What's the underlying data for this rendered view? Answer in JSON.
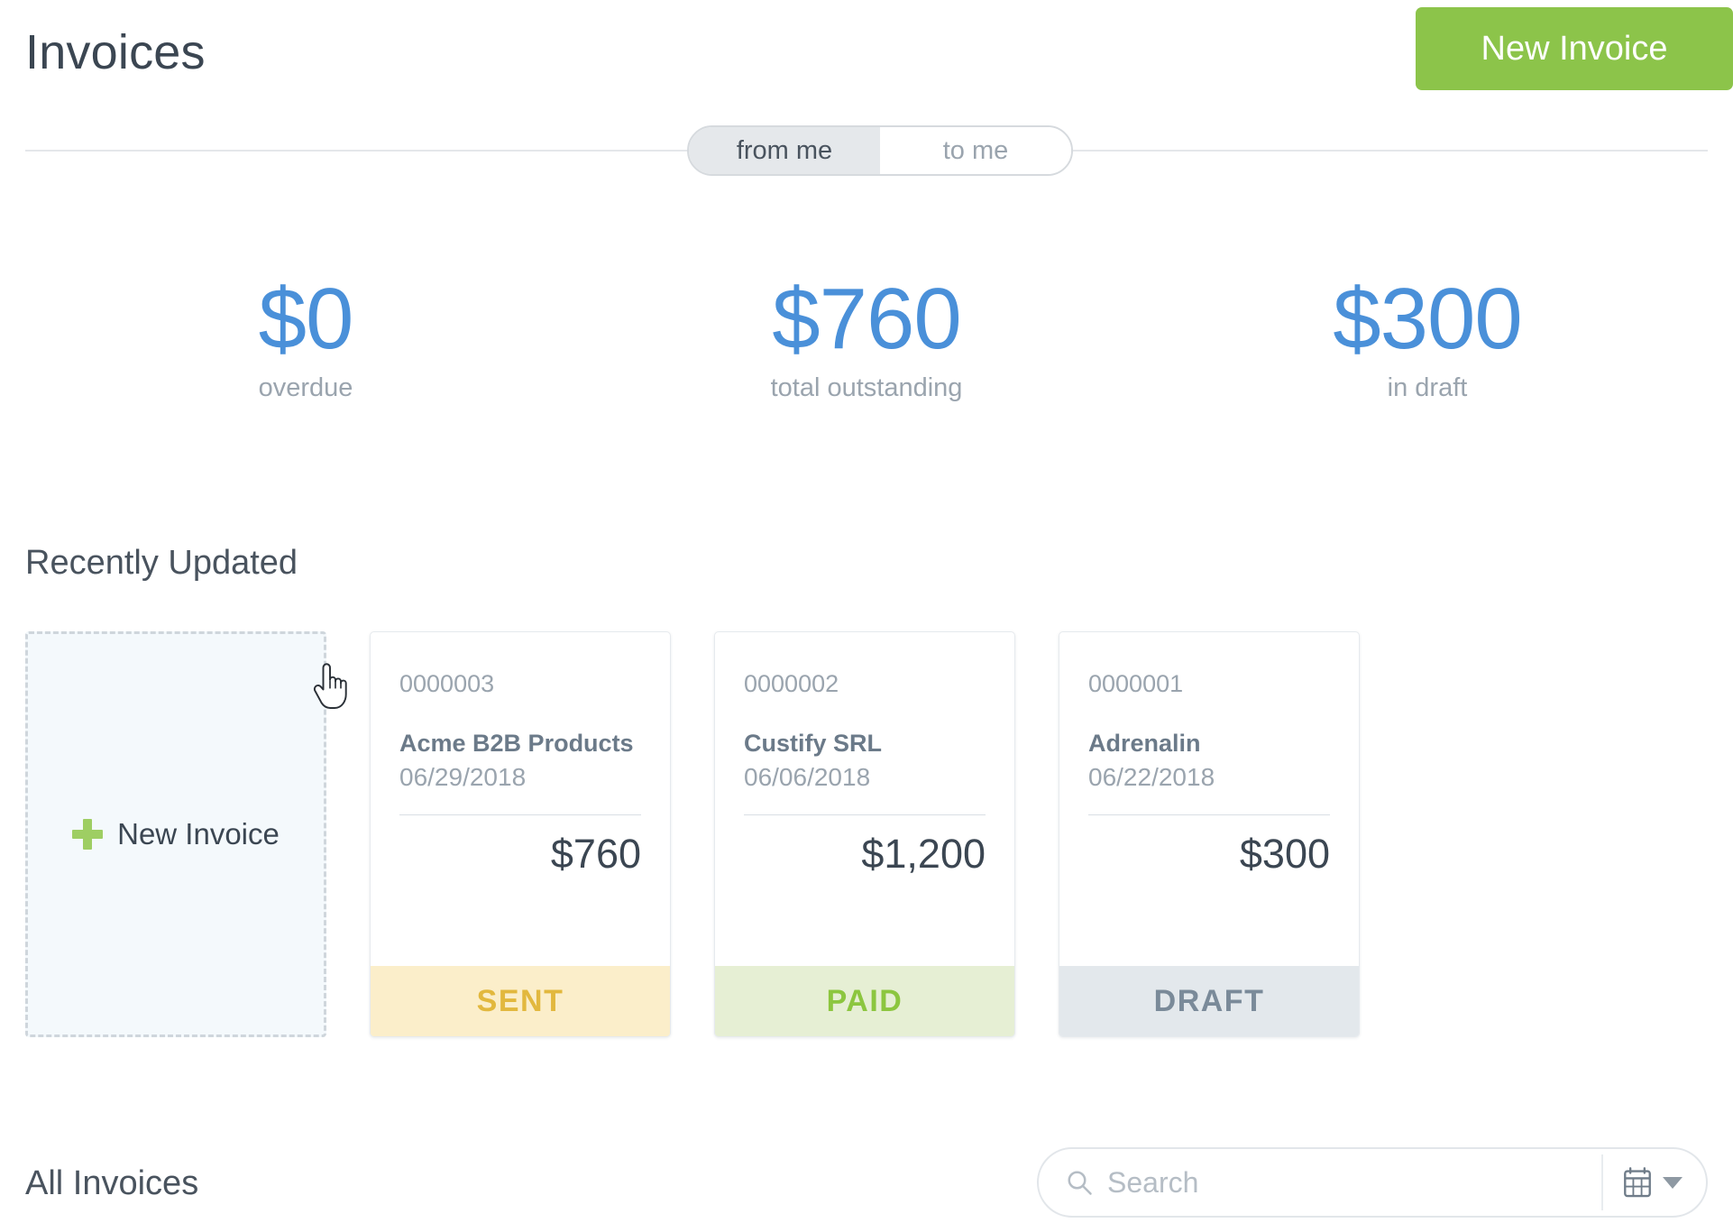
{
  "header": {
    "title": "Invoices",
    "new_invoice_label": "New Invoice"
  },
  "toggle": {
    "options": [
      {
        "label": "from me",
        "active": true
      },
      {
        "label": "to me",
        "active": false
      }
    ]
  },
  "stats": [
    {
      "value": "$0",
      "label": "overdue"
    },
    {
      "value": "$760",
      "label": "total outstanding"
    },
    {
      "value": "$300",
      "label": "in draft"
    }
  ],
  "sections": {
    "recently_updated": "Recently Updated",
    "all_invoices": "All Invoices"
  },
  "new_invoice_card": {
    "label": "New Invoice",
    "icon": "plus-icon"
  },
  "cards": [
    {
      "number": "0000003",
      "client": "Acme B2B Products",
      "date": "06/29/2018",
      "amount": "$760",
      "status": "SENT",
      "status_bg": "#fbeeca",
      "status_color": "#e2b83e"
    },
    {
      "number": "0000002",
      "client": "Custify SRL",
      "date": "06/06/2018",
      "amount": "$1,200",
      "status": "PAID",
      "status_bg": "#e6efd4",
      "status_color": "#8cc63f"
    },
    {
      "number": "0000001",
      "client": "Adrenalin",
      "date": "06/22/2018",
      "amount": "$300",
      "status": "DRAFT",
      "status_bg": "#e3e8ec",
      "status_color": "#7a8a99"
    }
  ],
  "search": {
    "placeholder": "Search",
    "value": "",
    "search_icon": "search-icon",
    "calendar_icon": "calendar-icon",
    "caret_icon": "chevron-down-icon"
  },
  "colors": {
    "accent_green": "#8cc44a",
    "accent_blue": "#4a90d9",
    "text_dark": "#3b4652",
    "text_muted": "#9aa4ae"
  }
}
